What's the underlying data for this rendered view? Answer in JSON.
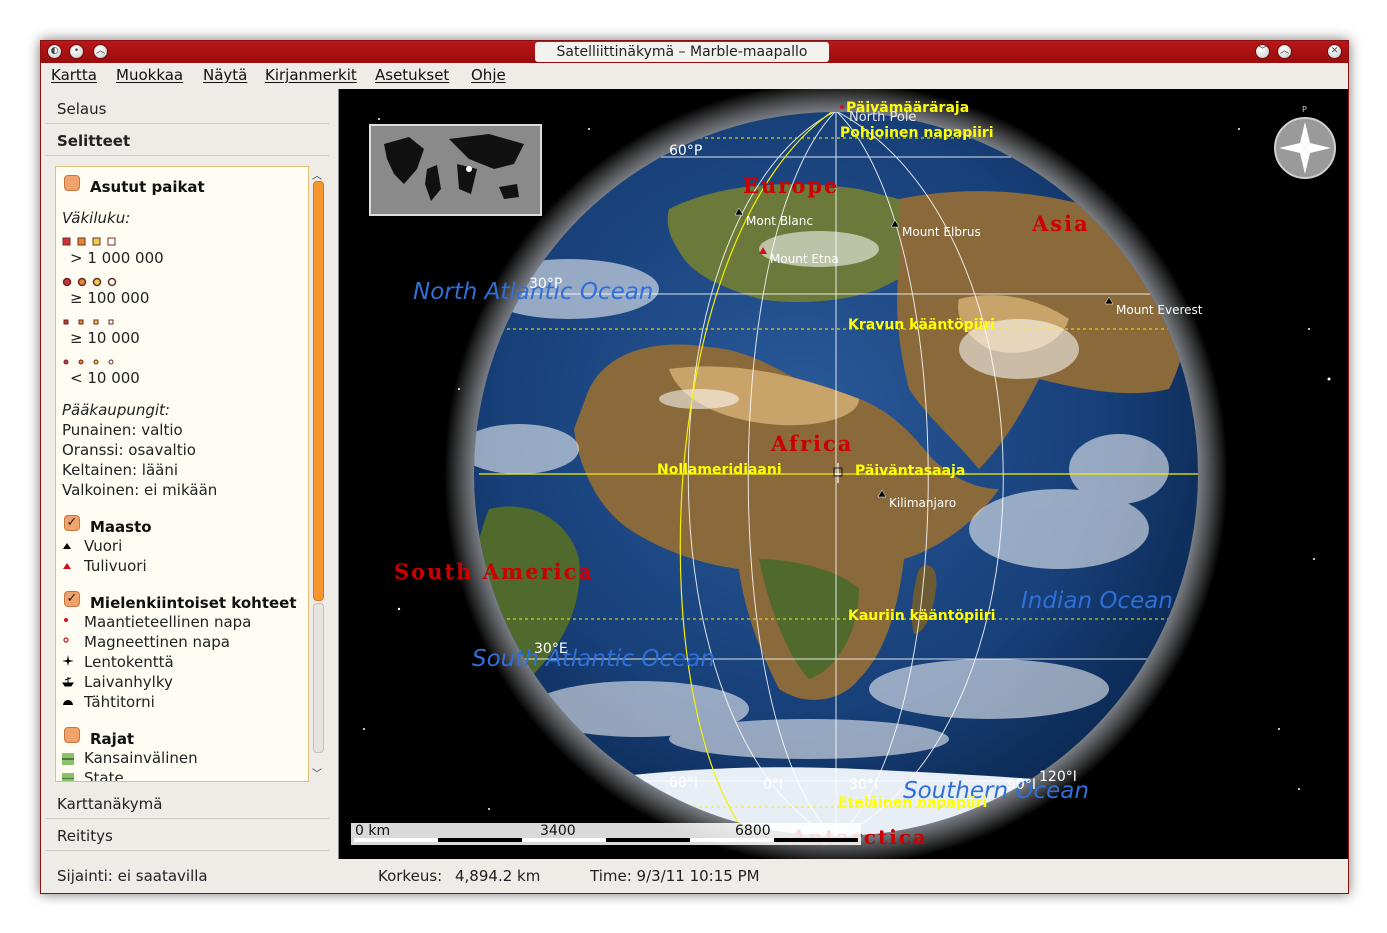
{
  "window": {
    "title": "Satelliittinäkymä – Marble-maapallo"
  },
  "menu": [
    "Kartta",
    "Muokkaa",
    "Näytä",
    "Kirjanmerkit",
    "Asetukset",
    "Ohje"
  ],
  "sidebar": {
    "tabs_top": [
      "Selaus",
      "Selitteet"
    ],
    "tabs_bottom": [
      "Karttanäkymä",
      "Reititys"
    ],
    "legend": {
      "populated": {
        "title": "Asutut paikat",
        "checked": false,
        "population_label": "Väkiluku:",
        "levels": [
          "> 1 000 000",
          "≥ 100 000",
          "≥ 10 000",
          "< 10 000"
        ],
        "capitals_label": "Pääkaupungit:",
        "capitals": [
          "Punainen: valtio",
          "Oranssi: osavaltio",
          "Keltainen: lääni",
          "Valkoinen: ei mikään"
        ]
      },
      "terrain": {
        "title": "Maasto",
        "checked": true,
        "items": [
          "Vuori",
          "Tulivuori"
        ]
      },
      "poi": {
        "title": "Mielenkiintoiset kohteet",
        "checked": true,
        "items": [
          "Maantieteellinen napa",
          "Magneettinen napa",
          "Lentokenttä",
          "Laivanhylky",
          "Tähtitorni"
        ]
      },
      "borders": {
        "title": "Rajat",
        "checked": false,
        "items": [
          "Kansainvälinen",
          "State"
        ]
      }
    }
  },
  "map": {
    "continents": [
      "Europe",
      "Asia",
      "Africa",
      "South America",
      "Antarctica"
    ],
    "oceans": [
      "North Atlantic Ocean",
      "Indian Ocean",
      "South Atlantic Ocean",
      "Southern Ocean"
    ],
    "peaks": [
      "Mont Blanc",
      "Mount Etna",
      "Mount Elbrus",
      "Mount Everest",
      "Kilimanjaro"
    ],
    "poles": [
      "North Pole"
    ],
    "lines": [
      "Päivämääräraja",
      "Pohjoinen napapiiri",
      "Kravun kääntöpiiri",
      "Nollameridiaani",
      "Päiväntasaaja",
      "Kauriin kääntöpiiri",
      "Eteläinen napapiiri"
    ],
    "grid_labels": [
      "60°P",
      "30°P",
      "30°E",
      "60°I",
      "0°I",
      "30°I",
      "90°I",
      "120°I"
    ],
    "scale": [
      "0 km",
      "3400",
      "6800"
    ]
  },
  "status": {
    "location": "Sijainti: ei saatavilla",
    "altitude_label": "Korkeus:",
    "altitude_value": "4,894.2 km",
    "time": "Time: 9/3/11 10:15 PM"
  },
  "colors": {
    "titlebar": "#a81010",
    "accent_orange": "#f5972e",
    "continent_label": "#cc0000",
    "ocean_label": "#2f6fd6",
    "line_label": "#ffff00"
  }
}
